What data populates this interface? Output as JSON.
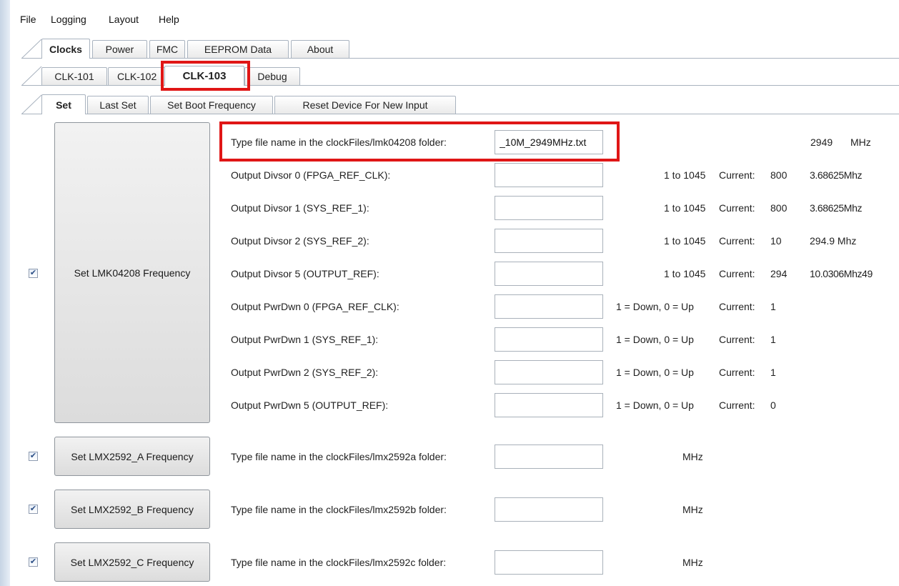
{
  "menubar": {
    "items": [
      "File",
      "Logging",
      "Layout",
      "Help"
    ]
  },
  "tabs_main": {
    "items": [
      "Clocks",
      "Power",
      "FMC",
      "EEPROM Data",
      "About"
    ],
    "active": "Clocks"
  },
  "tabs_clk": {
    "items": [
      "CLK-101",
      "CLK-102",
      "CLK-103",
      "Debug"
    ],
    "active": "CLK-103"
  },
  "tabs_set": {
    "items": [
      "Set",
      "Last Set",
      "Set Boot Frequency",
      "Reset Device For New Input"
    ],
    "active": "Set"
  },
  "lmk": {
    "button_label": "Set LMK04208 Frequency",
    "checked": true,
    "file_label": "Type file name in the clockFiles/lmk04208 folder:",
    "file_value": "_10M_2949MHz.txt",
    "freq_value": "2949",
    "freq_unit": "MHz",
    "rows": [
      {
        "label": "Output Divsor 0 (FPGA_REF_CLK):",
        "range": "1 to 1045",
        "current_label": "Current:",
        "current": "800",
        "result": "3.68625Mhz"
      },
      {
        "label": "Output Divsor 1 (SYS_REF_1):",
        "range": "1 to 1045",
        "current_label": "Current:",
        "current": "800",
        "result": "3.68625Mhz"
      },
      {
        "label": "Output Divsor 2 (SYS_REF_2):",
        "range": "1 to 1045",
        "current_label": "Current:",
        "current": "10",
        "result": "294.9 Mhz"
      },
      {
        "label": "Output Divsor 5 (OUTPUT_REF):",
        "range": "1 to 1045",
        "current_label": "Current:",
        "current": "294",
        "result": "10.0306Mhz49"
      },
      {
        "label": "Output PwrDwn 0 (FPGA_REF_CLK):",
        "range": "1 = Down, 0 = Up",
        "current_label": "Current:",
        "current": "1",
        "result": ""
      },
      {
        "label": "Output PwrDwn 1 (SYS_REF_1):",
        "range": "1 = Down, 0 = Up",
        "current_label": "Current:",
        "current": "1",
        "result": ""
      },
      {
        "label": "Output PwrDwn 2 (SYS_REF_2):",
        "range": "1 = Down, 0 = Up",
        "current_label": "Current:",
        "current": "1",
        "result": ""
      },
      {
        "label": "Output PwrDwn 5 (OUTPUT_REF):",
        "range": "1 = Down, 0 = Up",
        "current_label": "Current:",
        "current": "0",
        "result": ""
      }
    ]
  },
  "lmx": [
    {
      "button_label": "Set LMX2592_A Frequency",
      "checked": true,
      "file_label": "Type file name in the clockFiles/lmx2592a folder:",
      "file_value": "",
      "unit": "MHz"
    },
    {
      "button_label": "Set LMX2592_B Frequency",
      "checked": true,
      "file_label": "Type file name in the clockFiles/lmx2592b folder:",
      "file_value": "",
      "unit": "MHz"
    },
    {
      "button_label": "Set LMX2592_C Frequency",
      "checked": true,
      "file_label": "Type file name in the clockFiles/lmx2592c folder:",
      "file_value": "",
      "unit": "MHz"
    }
  ],
  "colors": {
    "highlight": "#e01616",
    "border": "#a9b3bf",
    "check": "#2c4f86"
  },
  "icons": {
    "checkmark": "check-icon"
  }
}
